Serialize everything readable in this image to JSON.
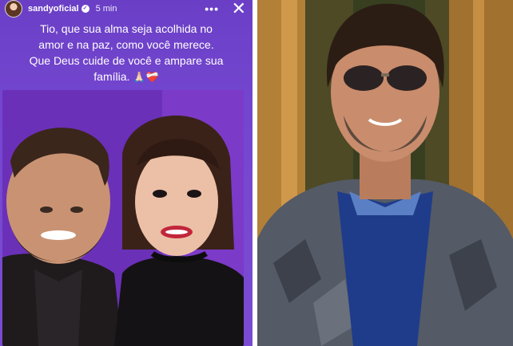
{
  "story": {
    "username": "sandyoficial",
    "verified_icon": "verified-badge-icon",
    "time_ago": "5 min",
    "more_icon": "more-options-icon",
    "close_icon": "close-icon",
    "caption_line_1": "Tio, que sua alma seja acolhida no",
    "caption_line_2": "amor e na paz, como você merece.",
    "caption_line_3": "Que Deus cuide de você e ampare sua",
    "caption_line_4": "família.",
    "caption_emojis": "🙏🏻❤️‍🩹",
    "accent_color": "#7446cf"
  }
}
